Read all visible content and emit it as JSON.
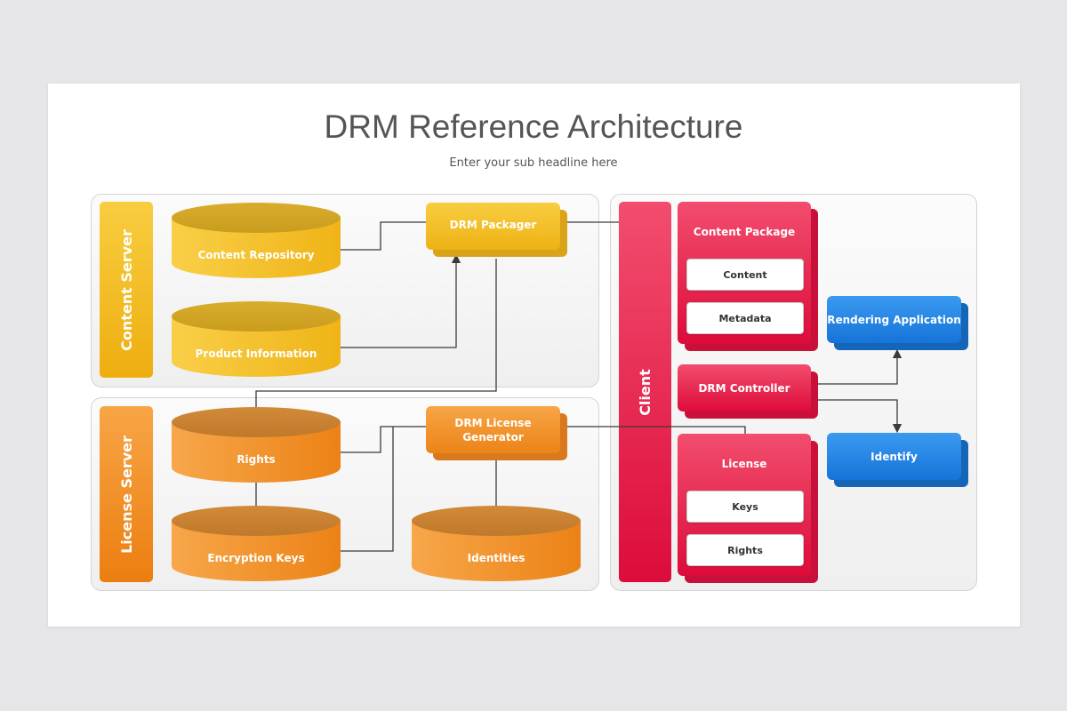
{
  "title": "DRM Reference Architecture",
  "subtitle": "Enter your sub headline here",
  "content_server": {
    "label": "Content Server",
    "content_repository": "Content Repository",
    "product_information": "Product Information",
    "drm_packager": "DRM Packager"
  },
  "license_server": {
    "label": "License Server",
    "rights": "Rights",
    "encryption_keys": "Encryption Keys",
    "drm_license_generator": "DRM License Generator",
    "identities": "Identities"
  },
  "client": {
    "label": "Client",
    "content_package": {
      "title": "Content Package",
      "items": [
        "Content",
        "Metadata"
      ]
    },
    "drm_controller": "DRM Controller",
    "license": {
      "title": "License",
      "items": [
        "Keys",
        "Rights"
      ]
    },
    "rendering_application": "Rendering Application",
    "identify": "Identify"
  },
  "colors": {
    "yellow": "#f3c12c",
    "orange": "#f39a2e",
    "red": "#e8264f",
    "blue": "#1f86e0",
    "line": "#3a3a3a"
  }
}
